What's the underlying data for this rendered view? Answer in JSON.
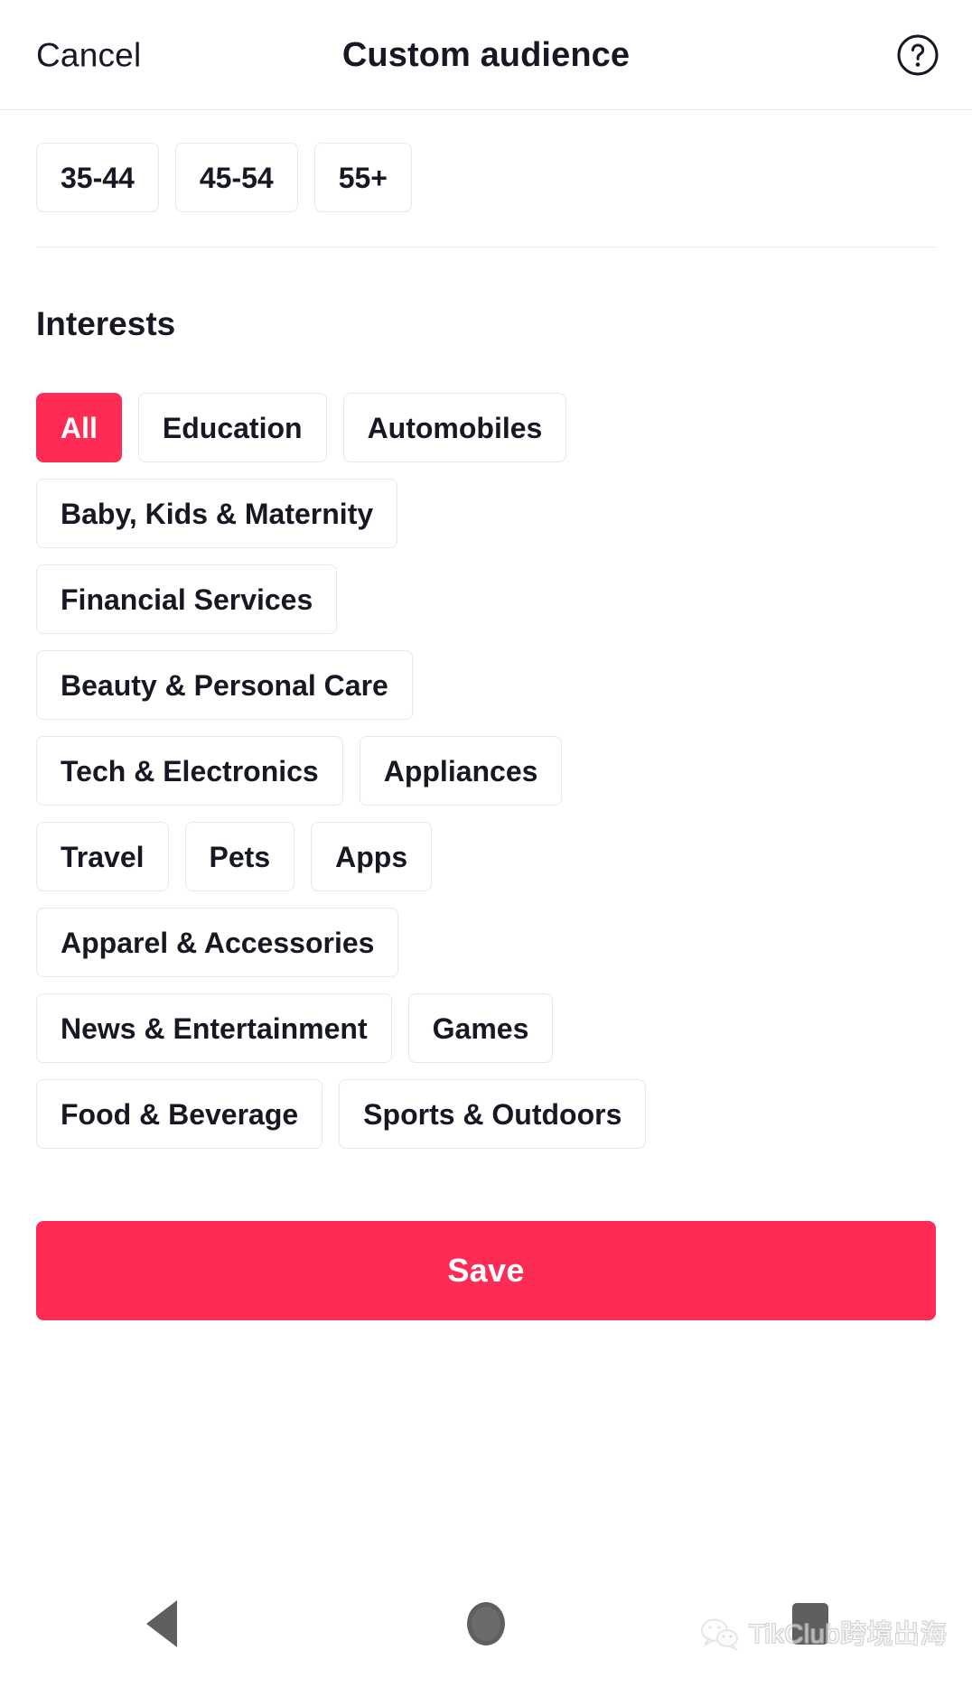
{
  "header": {
    "cancel_label": "Cancel",
    "title": "Custom audience",
    "help_icon": "question-mark-circle-icon"
  },
  "age_section": {
    "chips": [
      {
        "label": "35-44",
        "selected": false
      },
      {
        "label": "45-54",
        "selected": false
      },
      {
        "label": "55+",
        "selected": false
      }
    ]
  },
  "interests_section": {
    "title": "Interests",
    "rows": [
      [
        {
          "label": "All",
          "selected": true
        },
        {
          "label": "Education",
          "selected": false
        },
        {
          "label": "Automobiles",
          "selected": false
        }
      ],
      [
        {
          "label": "Baby, Kids & Maternity",
          "selected": false
        }
      ],
      [
        {
          "label": "Financial Services",
          "selected": false
        }
      ],
      [
        {
          "label": "Beauty & Personal Care",
          "selected": false
        }
      ],
      [
        {
          "label": "Tech & Electronics",
          "selected": false
        },
        {
          "label": "Appliances",
          "selected": false
        }
      ],
      [
        {
          "label": "Travel",
          "selected": false
        },
        {
          "label": "Pets",
          "selected": false
        },
        {
          "label": "Apps",
          "selected": false
        }
      ],
      [
        {
          "label": "Apparel & Accessories",
          "selected": false
        }
      ],
      [
        {
          "label": "News & Entertainment",
          "selected": false
        },
        {
          "label": "Games",
          "selected": false
        }
      ],
      [
        {
          "label": "Food & Beverage",
          "selected": false
        },
        {
          "label": "Sports & Outdoors",
          "selected": false
        }
      ]
    ]
  },
  "footer": {
    "save_label": "Save"
  },
  "navbar": {
    "back": "back-triangle-icon",
    "home": "home-circle-icon",
    "recents": "recents-square-icon"
  },
  "watermark": {
    "text": "TikClub跨境出海",
    "icon": "wechat-bubble-icon"
  },
  "colors": {
    "accent": "#fe2c55",
    "text": "#161823",
    "chip_border": "#e8e8e8",
    "divider": "#ededed"
  }
}
